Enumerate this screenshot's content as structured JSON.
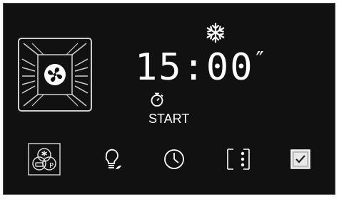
{
  "display": {
    "time_main": "15:00",
    "time_seconds_mark": "″",
    "start_label": "START"
  },
  "icons": {
    "fan": "fan-heating-icon",
    "snowflake": "defrost-snowflake-icon",
    "timer": "stopwatch-icon",
    "mode": "defrost-mode-icon",
    "light": "light-bulb-icon",
    "clock": "clock-icon",
    "menu": "more-options-icon",
    "confirm": "checkbox-confirm-icon"
  },
  "colors": {
    "panel_bg": "#111111",
    "foreground": "#ffffff",
    "icon_grey": "#cccccc"
  }
}
